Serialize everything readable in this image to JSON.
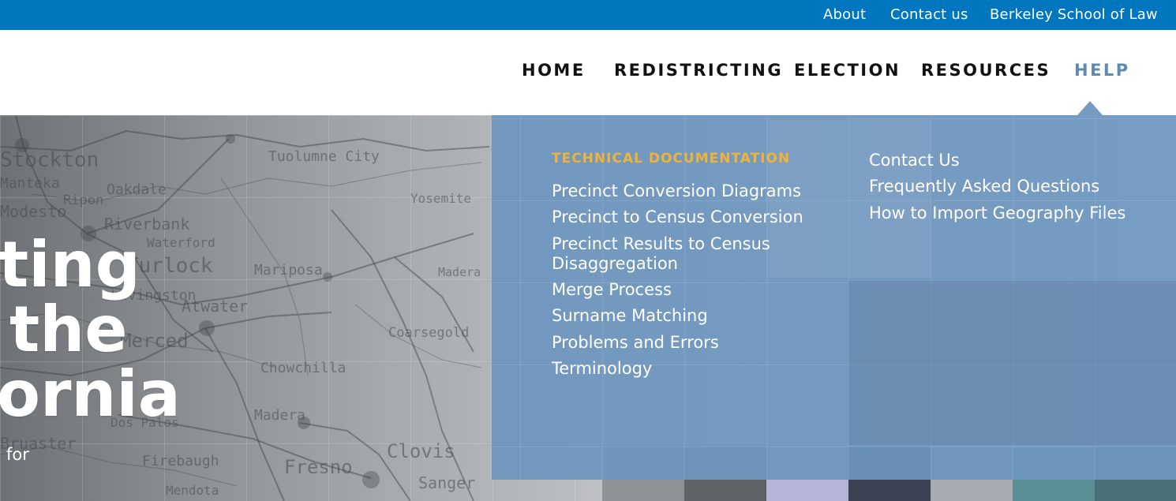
{
  "utility_nav": {
    "about": "About",
    "contact": "Contact us",
    "law_school": "Berkeley School of Law"
  },
  "main_nav": {
    "home": "HOME",
    "redistricting": "REDISTRICTING",
    "election": "ELECTION",
    "resources": "RESOURCES",
    "help": "HELP"
  },
  "hero": {
    "title_line1": "ting",
    "title_line2": "the",
    "title_line3": "ornia",
    "subtitle": "for",
    "map_labels": [
      "Stockton",
      "Manteka",
      "Oakdale",
      "Ripon",
      "Riverbank",
      "Waterford",
      "Turlock",
      "Tuolumne City",
      "Mariposa",
      "Atwater",
      "Merced",
      "Chowchilla",
      "Madera",
      "Coarsegold",
      "Dos Palos",
      "Firebaugh",
      "Fresno",
      "Clovis",
      "Mendota",
      "Sanger",
      "Yosemite",
      "Livingston",
      "Modesto",
      "Madera",
      "Bruaster"
    ]
  },
  "help_menu": {
    "technical_heading": "TECHNICAL DOCUMENTATION",
    "technical_links": [
      "Precinct Conversion Diagrams",
      "Precinct to Census Conversion",
      "Precinct Results to Census",
      "Disaggregation",
      "Merge Process",
      "Surname Matching",
      "Problems and Errors",
      "Terminology"
    ],
    "support_links": [
      "Contact Us",
      "Frequently Asked Questions",
      "How to Import Geography Files"
    ]
  },
  "colors": {
    "topbar": "#0076bf",
    "dropdown": "#6e96be",
    "heading_accent": "#f0b33a",
    "active_nav": "#5f89b3"
  }
}
